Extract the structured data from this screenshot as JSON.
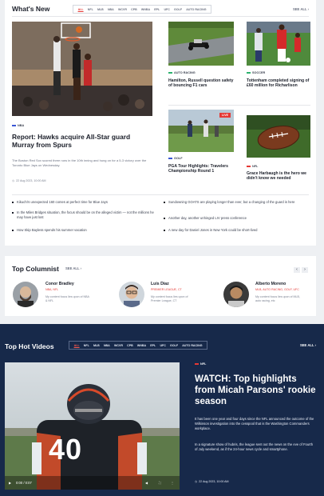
{
  "whats_new": {
    "title": "What's New",
    "tabs": [
      "ALL",
      "NFL",
      "MLB",
      "NBA",
      "WCVR",
      "CPB",
      "WNBA",
      "EPL",
      "UFC",
      "GOLF",
      "AUTO RACING"
    ],
    "see_all": "SEE ALL",
    "feature": {
      "tag": "NBA",
      "headline": "Report: Hawks acquire All-Star guard Murray from Spurs",
      "excerpt": "The Boston Red Sox scored three runs in the 10th inning and hung on for a 5-3 victory over the Toronto Blue Jays on Wednesday.",
      "date": "22 Aug 2023, 10:00 AM"
    },
    "cards": [
      {
        "tag": "AUTO RACING",
        "headline": "Hamilton, Russell question safety of bouncing F1 cars",
        "color": "#2db36f"
      },
      {
        "tag": "SOCCER",
        "headline": "Tottenham completed signing of £60 million for Richarlison",
        "color": "#2db36f"
      },
      {
        "tag": "GOLF",
        "headline": "PGA Tour Highlights: Travelers Championship Round 1",
        "color": "#3a56d4",
        "badge": "LIVE"
      },
      {
        "tag": "NFL",
        "headline": "Grace Harbaugh is the hero we didn't know we needed",
        "color": "#e53935"
      }
    ],
    "bullets": [
      "Kikuchi's unexpected 160 comes at perfect time for Blue Jays",
      "In the Miles Bridges situation, the focus should be on the alleged victim — not the millions he may have just lost",
      "How Skip Bayless spends his summer vacation",
      "Sundowning GOATS are playing longer than ever, but a changing of the guard is here",
      "Another day, another unhinged LIV press conference",
      "A new day for Daniel Jones in New York could be short-lived"
    ]
  },
  "columnist": {
    "title": "Top Columnist",
    "see_all": "SEE ALL",
    "people": [
      {
        "name": "Conor Bradley",
        "team": "NBA, NFL",
        "desc": "My content focus lies upon of NBA & NFL"
      },
      {
        "name": "Luis Diaz",
        "team": "PREMIER LEAGUE, CT",
        "desc": "My content focus lies upon of Premier League, CT"
      },
      {
        "name": "Alberto Moreno",
        "team": "MLB, AUTO RACING, GOLF, UFC",
        "desc": "My content focus lies upon of MLB, auto racing, etc"
      }
    ],
    "prev": "‹",
    "next": "›"
  },
  "hot_videos": {
    "title": "Top Hot Videos",
    "tabs": [
      "ALL",
      "NFL",
      "MLB",
      "NBA",
      "WCVR",
      "CPB",
      "WNBA",
      "EPL",
      "UFC",
      "GOLF",
      "AUTO RACING"
    ],
    "see_all": "SEE ALL",
    "tag": "NFL",
    "headline": "WATCH: Top highlights from Micah Parsons' rookie season",
    "para1": "It has been one year and four days since the NFL announced the outcome of the Wilkinson investigation into the cesspool that is the Washington Commanders workplace.",
    "para2": "In a signature show of hubris, the league sent out the news on the eve of Fourth of July weekend, as if the 24-hour news cycle and smartphone.",
    "date": "22 Aug 2023, 10:00 AM",
    "time": "0:00 / 0:07",
    "jersey": "40",
    "colors": {
      "accent": "#e53935",
      "navy": "#17294a"
    }
  }
}
